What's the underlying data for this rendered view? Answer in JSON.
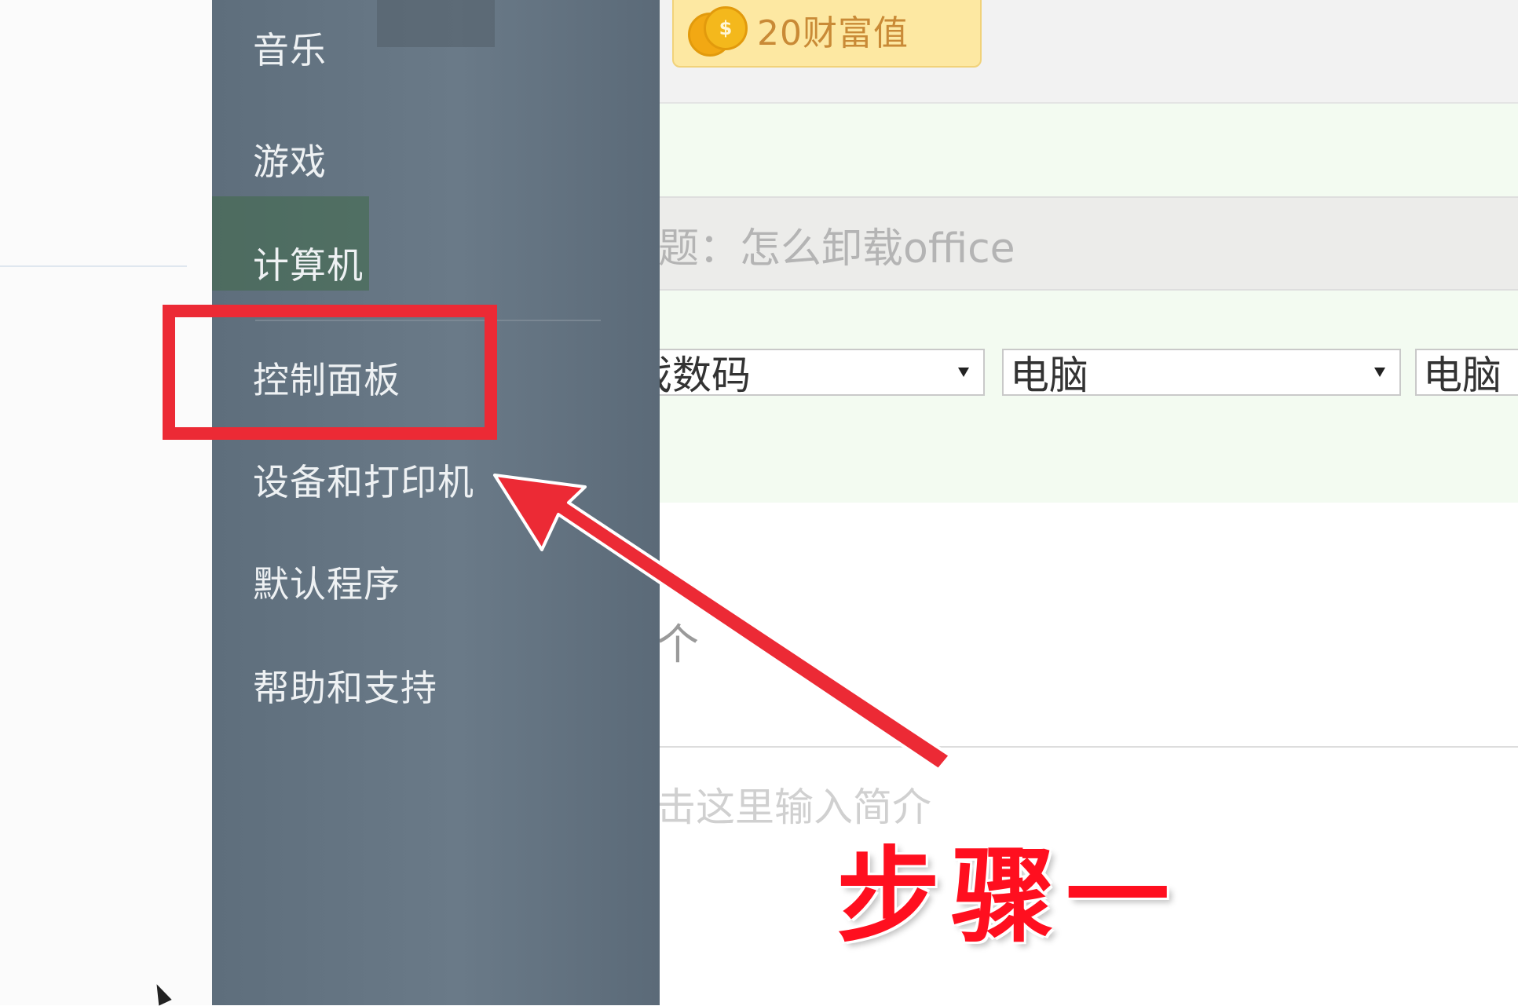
{
  "start_menu": {
    "items": [
      {
        "id": "music",
        "label": "音乐"
      },
      {
        "id": "games",
        "label": "游戏"
      },
      {
        "id": "computer",
        "label": "计算机"
      },
      {
        "id": "control-panel",
        "label": "控制面板"
      },
      {
        "id": "devices-printers",
        "label": "设备和打印机"
      },
      {
        "id": "default-programs",
        "label": "默认程序"
      },
      {
        "id": "help-support",
        "label": "帮助和支持"
      }
    ],
    "highlighted_item": "控制面板"
  },
  "page": {
    "wealth_badge": "20财富值",
    "title_field": "题：怎么卸载office",
    "categories": [
      {
        "value": "戏数码"
      },
      {
        "value": "电脑"
      },
      {
        "value": "电脑"
      }
    ],
    "partial_text": "个",
    "intro_placeholder": "击这里输入简介"
  },
  "annotation": {
    "step_label": "步骤一",
    "highlight_color": "#ec2a35",
    "arrow_color": "#ec2a35"
  }
}
